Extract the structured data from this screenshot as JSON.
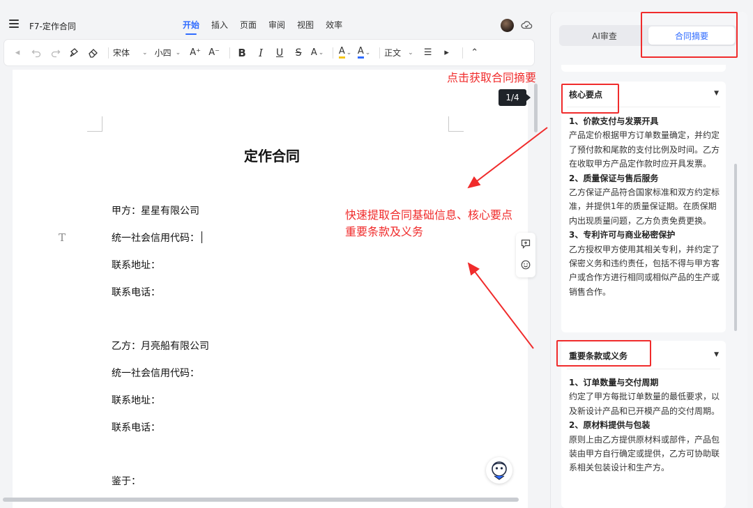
{
  "header": {
    "doc_title": "F7-定作合同",
    "tabs": [
      {
        "label": "开始",
        "active": true
      },
      {
        "label": "插入"
      },
      {
        "label": "页面"
      },
      {
        "label": "审阅"
      },
      {
        "label": "视图"
      },
      {
        "label": "效率"
      }
    ]
  },
  "toolbar": {
    "font_family": "宋体",
    "font_size": "小四",
    "grow_font": "A⁺",
    "shrink_font": "A⁻",
    "bold": "B",
    "italic": "I",
    "underline": "U",
    "strike": "S",
    "font_effect": "A",
    "highlight": "A",
    "font_color": "A",
    "paragraph_style": "正文",
    "accent_color": "#2f6bff",
    "highlight_color": "#f5c518",
    "font_color_value": "#2f6bff"
  },
  "document": {
    "title": "定作合同",
    "page_indicator": "1/4",
    "lines": [
      "甲方：星星有限公司",
      "统一社会信用代码：",
      "联系地址：",
      "联系电话：",
      "乙方：月亮船有限公司",
      "统一社会信用代码：",
      "联系地址：",
      "联系电话：",
      "鉴于："
    ],
    "text_marker": "T"
  },
  "panel": {
    "tabs": [
      {
        "label": "AI审查"
      },
      {
        "label": "合同摘要",
        "active": true
      }
    ],
    "sections": [
      {
        "title": "核心要点",
        "items": [
          {
            "heading": "1、价款支付与发票开具",
            "text": "产品定价根据甲方订单数量确定，并约定了预付款和尾款的支付比例及时间。乙方在收取甲方产品定作款时应开具发票。"
          },
          {
            "heading": "2、质量保证与售后服务",
            "text": "乙方保证产品符合国家标准和双方约定标准，并提供1年的质量保证期。在质保期内出现质量问题，乙方负责免费更换。"
          },
          {
            "heading": "3、专利许可与商业秘密保护",
            "text": "乙方授权甲方使用其相关专利，并约定了保密义务和违约责任，包括不得与甲方客户或合作方进行相同或相似产品的生产或销售合作。"
          }
        ]
      },
      {
        "title": "重要条款或义务",
        "items": [
          {
            "heading": "1、订单数量与交付周期",
            "text": "约定了甲方每批订单数量的最低要求，以及新设计产品和已开模产品的交付周期。"
          },
          {
            "heading": "2、原材料提供与包装",
            "text": "原则上由乙方提供原材料或部件，产品包装由甲方自行确定或提供，乙方可协助联系相关包装设计和生产方。"
          }
        ]
      }
    ]
  },
  "annotations": {
    "click_summary": "点击获取合同摘要",
    "extract_line1": "快速提取合同基础信息、核心要点",
    "extract_line2": "重要条款及义务",
    "color": "#f02b2b"
  }
}
